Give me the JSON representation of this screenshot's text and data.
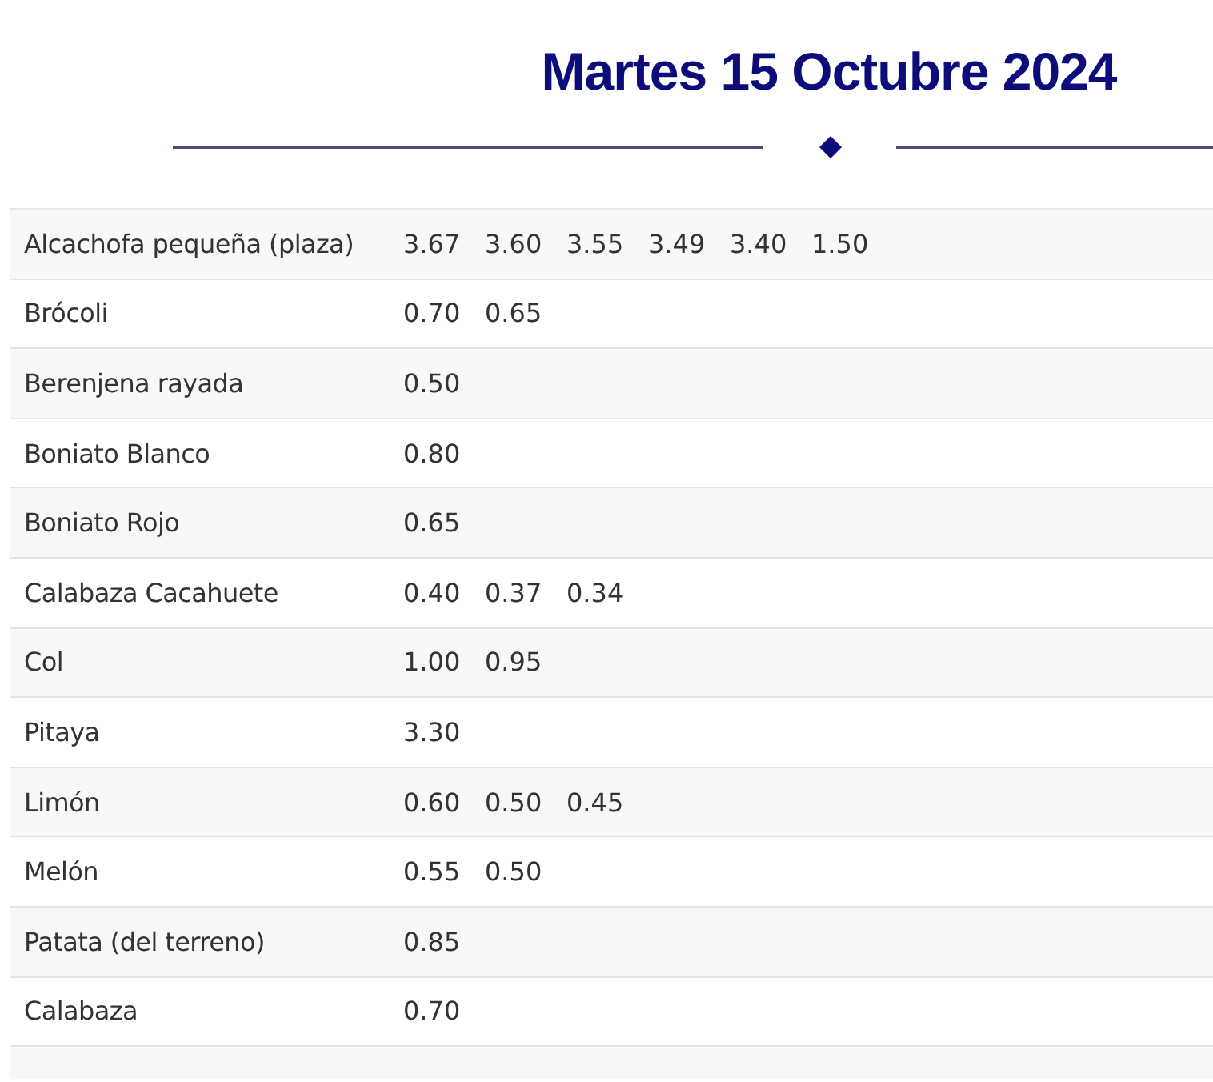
{
  "title": "Martes 15 Octubre 2024",
  "rows": [
    {
      "name": "Alcachofa pequeña (plaza)",
      "prices": [
        "3.67",
        "3.60",
        "3.55",
        "3.49",
        "3.40",
        "1.50"
      ]
    },
    {
      "name": "Brócoli",
      "prices": [
        "0.70",
        "0.65"
      ]
    },
    {
      "name": "Berenjena rayada",
      "prices": [
        "0.50"
      ]
    },
    {
      "name": "Boniato Blanco",
      "prices": [
        "0.80"
      ]
    },
    {
      "name": "Boniato Rojo",
      "prices": [
        "0.65"
      ]
    },
    {
      "name": "Calabaza Cacahuete",
      "prices": [
        "0.40",
        "0.37",
        "0.34"
      ]
    },
    {
      "name": "Col",
      "prices": [
        "1.00",
        "0.95"
      ]
    },
    {
      "name": "Pitaya",
      "prices": [
        "3.30"
      ]
    },
    {
      "name": "Limón",
      "prices": [
        "0.60",
        "0.50",
        "0.45"
      ]
    },
    {
      "name": "Melón",
      "prices": [
        "0.55",
        "0.50"
      ]
    },
    {
      "name": "Patata (del terreno)",
      "prices": [
        "0.85"
      ]
    },
    {
      "name": "Calabaza",
      "prices": [
        "0.70"
      ]
    }
  ]
}
